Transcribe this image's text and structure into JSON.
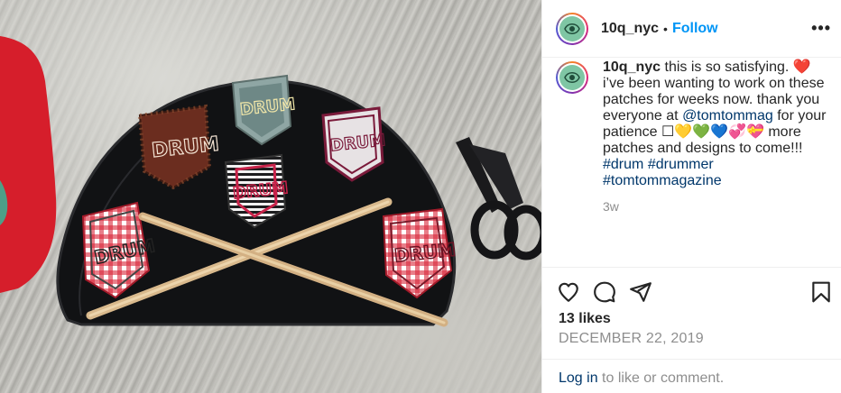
{
  "photo": {
    "alt": "",
    "patch_text": [
      "DRUM",
      "DRUM",
      "DRUM",
      "DRUM",
      "DRUM",
      "DRUM"
    ]
  },
  "header": {
    "username": "10q_nyc",
    "separator": "•",
    "follow_label": "Follow",
    "more_icon": "more-horizontal-icon",
    "more_glyph": "•••"
  },
  "caption": {
    "username": "10q_nyc",
    "text_1": " this is so satisfying. ",
    "heart": "❤️",
    "text_2": "  i’ve been wanting to work on these patches for weeks now. thank you everyone at ",
    "mention": "@tomtommag",
    "text_3": " for your patience ",
    "box": "☐",
    "emoji_yellow": "💛",
    "emoji_green": "💚",
    "emoji_blue": "💙",
    "emoji_pink1": "💞",
    "emoji_pink2": "💝",
    "text_4": "  more patches and designs to come!!! ",
    "hashtags": [
      "#drum",
      "#drummer",
      "#tomtommagazine"
    ],
    "time_ago": "3w"
  },
  "actions": {
    "like_icon": "heart-icon",
    "comment_icon": "comment-icon",
    "share_icon": "share-icon",
    "save_icon": "bookmark-icon",
    "likes": "13 likes",
    "date": "DECEMBER 22, 2019"
  },
  "login": {
    "link": "Log in",
    "rest": " to like or comment."
  },
  "colors": {
    "follow_blue": "#0095f6",
    "link_navy": "#00376b",
    "muted_gray": "#8e8e8e"
  }
}
